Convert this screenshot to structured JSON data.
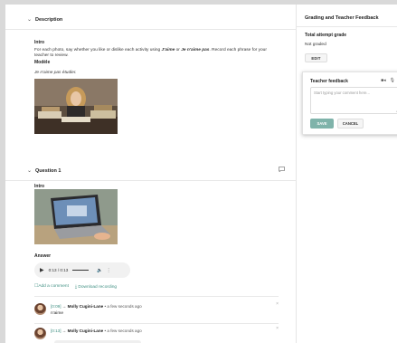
{
  "description": {
    "title": "Description",
    "intro_label": "Intro",
    "instructions_pre": "For each photo, say whether you like or dislike each activity using ",
    "instructions_a": "J'aime",
    "instructions_mid": " or ",
    "instructions_b": "Je n'aime pas",
    "instructions_post": ". Record each phrase for your teacher to review.",
    "modele_label": "Modèle",
    "example": "Je n'aime pas étudier."
  },
  "question": {
    "title": "Question 1",
    "intro_label": "Intro",
    "answer_label": "Answer",
    "player": {
      "time": "0:13 / 0:13",
      "progress": 1.0
    },
    "add_comment": "Add a comment",
    "download": "Download recording",
    "comments": [
      {
        "timestamp": "[0:09]",
        "arrow": "→",
        "name": "Molly Cugini-Lane",
        "sep": "•",
        "time": "a few seconds ago",
        "body": "n'aime"
      },
      {
        "timestamp": "[0:13]",
        "arrow": "→",
        "name": "Molly Cugini-Lane",
        "sep": "•",
        "time": "a few seconds ago",
        "body": ""
      }
    ]
  },
  "sidebar": {
    "title": "Grading and Teacher Feedback",
    "grade_label": "Total attempt grade",
    "grade_value": "Not graded",
    "edit_label": "EDIT",
    "feedback": {
      "title": "Teacher feedback",
      "placeholder": "Start typing your comment here...",
      "save_label": "SAVE",
      "cancel_label": "CANCEL"
    }
  },
  "icons": {
    "chevron": "chevron-down-icon",
    "video": "video-camera-icon",
    "mic": "microphone-icon",
    "chat": "chat-bubble-icon",
    "close": "close-icon"
  },
  "colors": {
    "accent": "#3f8f82",
    "save_button": "#7fb3aa"
  }
}
